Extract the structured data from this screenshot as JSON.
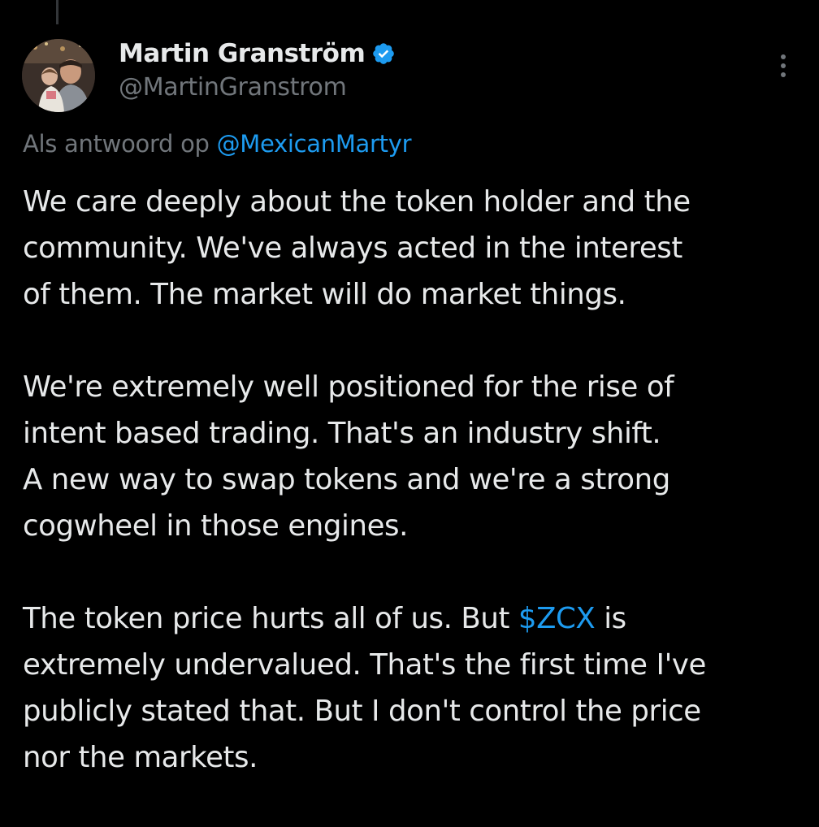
{
  "author": {
    "display_name": "Martin Granström",
    "handle": "@MartinGranstrom",
    "verified": true,
    "avatar_icon": "profile-photo"
  },
  "reply_context": {
    "prefix": "Als antwoord op",
    "mention": "@MexicanMartyr"
  },
  "tweet": {
    "paragraphs": [
      {
        "lines": [
          "We care deeply about the token holder and the",
          "community. We've always acted in the interest",
          "of them. The market will do market things."
        ]
      },
      {
        "lines": [
          "We're extremely well positioned for the rise of",
          "intent based trading. That's an industry shift.",
          "A new way to swap tokens and we're a strong",
          "cogwheel in those engines."
        ]
      },
      {
        "line1_before": "The token price hurts all of us. But ",
        "cashtag": "$ZCX",
        "line1_after": " is",
        "lines": [
          "extremely undervalued. That's the first time I've",
          "publicly stated that. But I don't control the price",
          "nor the markets."
        ]
      }
    ]
  },
  "icons": {
    "verified": "verified-badge-icon",
    "more": "more-options-icon"
  },
  "colors": {
    "background": "#000000",
    "text_primary": "#e7e9ea",
    "text_secondary": "#71767b",
    "accent": "#1d9bf0"
  }
}
